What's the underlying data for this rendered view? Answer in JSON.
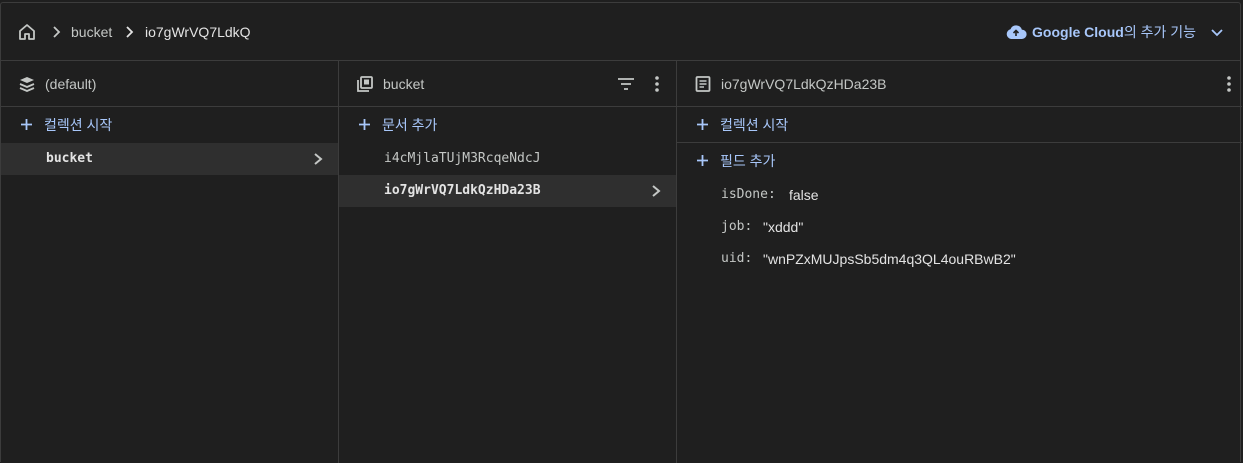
{
  "breadcrumb": {
    "items": [
      "bucket",
      "io7gWrVQ7LdkQ"
    ]
  },
  "header_actions": {
    "brand": "Google Cloud",
    "suffix": "의 추가 기능"
  },
  "panel_root": {
    "title": "(default)",
    "add_label": "컬렉션 시작",
    "items": [
      {
        "label": "bucket"
      }
    ]
  },
  "panel_collection": {
    "title": "bucket",
    "add_label": "문서 추가",
    "items": [
      {
        "label": "i4cMjlaTUjM3RcqeNdcJ"
      },
      {
        "label": "io7gWrVQ7LdkQzHDa23B"
      }
    ]
  },
  "panel_document": {
    "title": "io7gWrVQ7LdkQzHDa23B",
    "add_collection_label": "컬렉션 시작",
    "add_field_label": "필드 추가",
    "fields": [
      {
        "key": "isDone",
        "value": "false"
      },
      {
        "key": "job",
        "value": "\"xddd\""
      },
      {
        "key": "uid",
        "value": "\"wnPZxMUJpsSb5dm4q3QL4ouRBwB2\""
      }
    ]
  }
}
